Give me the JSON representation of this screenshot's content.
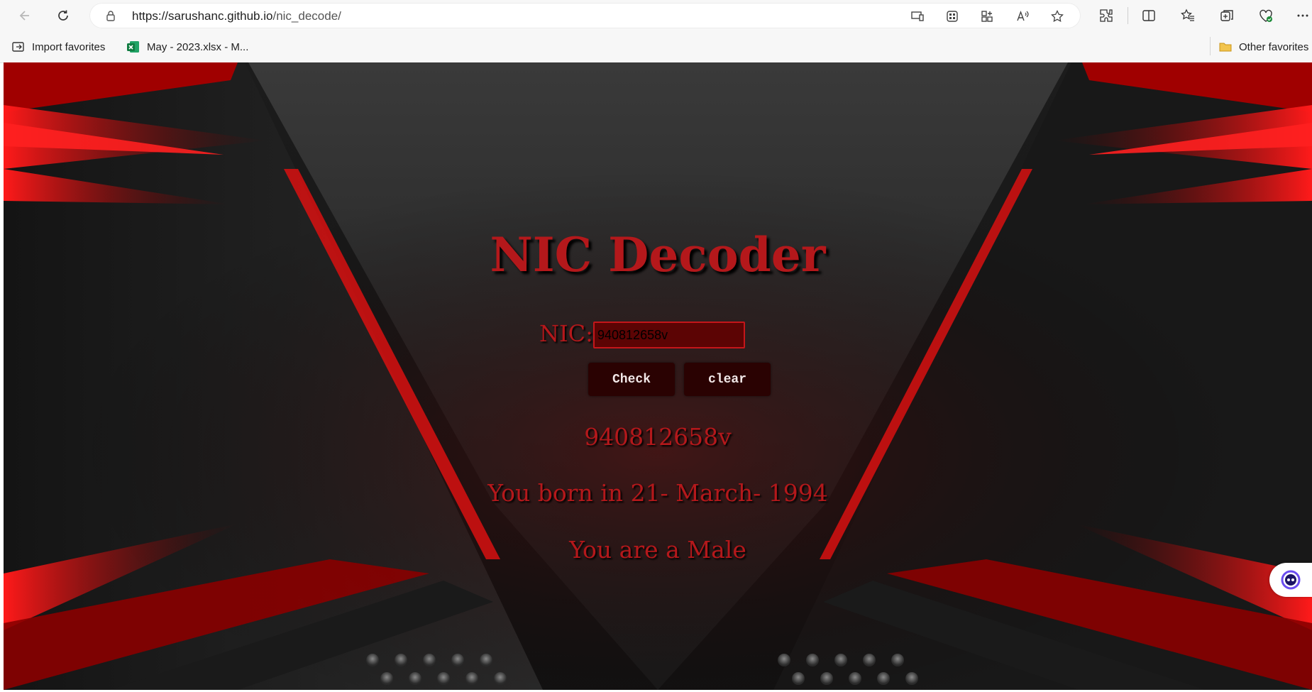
{
  "browser": {
    "url": "https://sarushanc.github.io/nic_decode/",
    "url_host": "https://sarushanc.github.io",
    "url_path": "/nic_decode/",
    "favorites": [
      {
        "label": "Import favorites",
        "icon": "import-icon"
      },
      {
        "label": "May - 2023.xlsx - M...",
        "icon": "excel-icon"
      }
    ],
    "other_favorites": "Other favorites"
  },
  "page": {
    "title": "NIC Decoder",
    "nic_label": "NIC:",
    "nic_value": "940812658v",
    "check_label": "Check",
    "clear_label": "clear",
    "result_nic": "940812658v",
    "result_birth": "You born in 21- March- 1994",
    "result_gender": "You are a Male"
  },
  "colors": {
    "accent_red": "#b4181b",
    "button_bg": "#2a0202",
    "input_bg": "#5c0404"
  }
}
